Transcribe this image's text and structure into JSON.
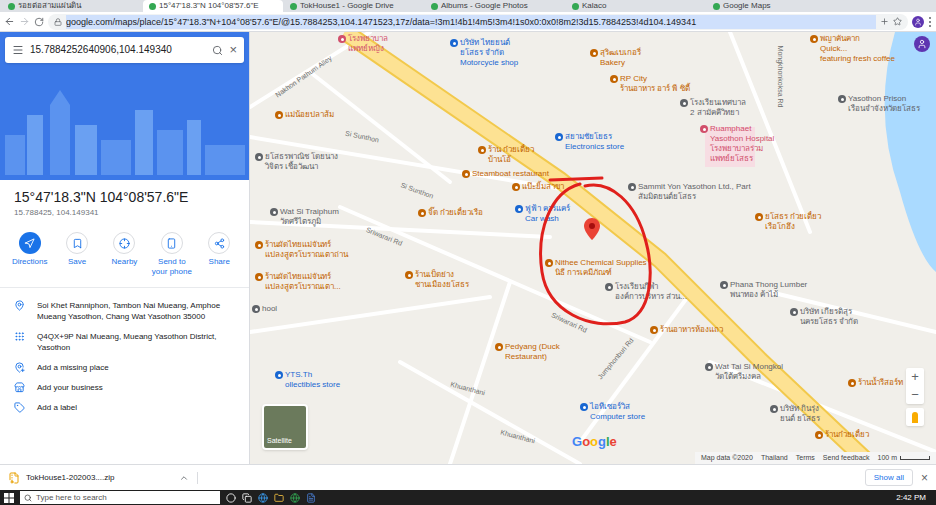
{
  "browser": {
    "tabs": [
      {
        "label": "รอยต่อสามแผ่นดิน",
        "selected": false
      },
      {
        "label": "15°47'18.3\"N 104°08'57.6\"E",
        "selected": true
      },
      {
        "label": "TokHouse1 - Google Drive",
        "selected": false
      },
      {
        "label": "Albums - Google Photos",
        "selected": false
      },
      {
        "label": "Kalaco",
        "selected": false
      },
      {
        "label": "Google Maps",
        "selected": false
      }
    ],
    "url": "google.com/maps/place/15°47'18.3\"N+104°08'57.6\"E/@15.7884253,104.1471523,17z/data=!3m1!4b1!4m5!3m4!1s0x0:0x0!8m2!3d15.7884253!4d104.149341"
  },
  "side_panel": {
    "search": {
      "value": "15.7884252640906,104.149340",
      "clear": "×"
    },
    "title": "15°47'18.3\"N 104°08'57.6\"E",
    "subtitle": "15.788425, 104.149341",
    "actions": [
      {
        "label": "Directions",
        "primary": true
      },
      {
        "label": "Save",
        "primary": false
      },
      {
        "label": "Nearby",
        "primary": false
      },
      {
        "label": "Send to your phone",
        "primary": false
      },
      {
        "label": "Share",
        "primary": false
      }
    ],
    "details": [
      {
        "text": "Soi Khet Ranniphon, Tambon Nai Mueang, Amphoe Mueang Yasothon, Chang Wat Yasothon 35000",
        "kind": "address"
      },
      {
        "text": "Q4QX+9P Nai Mueang, Mueang Yasothon District, Yasothon",
        "kind": "pluscode"
      },
      {
        "text": "Add a missing place",
        "kind": "place"
      },
      {
        "text": "Add your business",
        "kind": "business"
      },
      {
        "text": "Add a label",
        "kind": "label"
      }
    ]
  },
  "map": {
    "labels": [
      {
        "lines": [
          "โรงพยาบาล",
          "แพทย์หญิง"
        ],
        "color": "#d14f6b"
      },
      {
        "lines": [
          "บริษัท ไทยยนต์",
          "ยโสธร จำกัด",
          "Motorcycle shop"
        ],
        "color": "#1967d2"
      },
      {
        "lines": [
          "สุริฒเบเกอรี่",
          "Bakery"
        ],
        "color": "#c26401"
      },
      {
        "lines": [
          "RP City",
          "ร้านอาหาร อาร์ พี ซิตี้"
        ],
        "color": "#c26401"
      },
      {
        "lines": [
          "โรงเรียนเทศบาล",
          "2 สามัคคีวิทยา"
        ],
        "color": "#5f6368"
      },
      {
        "lines": [
          "พญาคันคาก",
          "Quick...",
          "featuring fresh coffee"
        ],
        "color": "#c26401"
      },
      {
        "lines": [
          "Yasothon Prison",
          "เรือนจำจังหวัดยโสธร"
        ],
        "color": "#5f6368"
      },
      {
        "lines": [
          "Ruamphaet",
          "Yasothon Hospital",
          "โรงพยาบาลร่วม",
          "แพทย์ยโสธร"
        ],
        "color": "#d14f6b"
      },
      {
        "lines": [
          "แม่น้อยปลาส้ม"
        ],
        "color": "#c26401"
      },
      {
        "lines": [
          "สยามชัยโยธร",
          "Electronics store"
        ],
        "color": "#1967d2"
      },
      {
        "lines": [
          "ร้าน ก๋วยเตี๋ยว",
          "บ้านโอ้"
        ],
        "color": "#c26401"
      },
      {
        "lines": [
          "Steamboat restaurant"
        ],
        "color": "#c26401"
      },
      {
        "lines": [
          "ยโสธรพาณิช โดยนาง",
          "วิจิตร เชื้อวัฒนา"
        ],
        "color": "#5f6368"
      },
      {
        "lines": [
          "แป๊ะยิ้มสาขา"
        ],
        "color": "#c26401"
      },
      {
        "lines": [
          "Wat Si Traiphum",
          "วัดศรีไตรภูมิ"
        ],
        "color": "#5f6368"
      },
      {
        "lines": [
          "จิ๊ด ก๋วยเตี๋ยวเรือ"
        ],
        "color": "#c26401"
      },
      {
        "lines": [
          "ฟูฟ้า คาร์แคร์",
          "Car wash"
        ],
        "color": "#1967d2"
      },
      {
        "lines": [
          "Sammit Yon Yasothon Ltd., Part",
          "สัมมิตยนต์ยโสธร"
        ],
        "color": "#5f6368"
      },
      {
        "lines": [
          "ยโสธร ก๋วยเตี๋ยว",
          "เรือโกฮึง"
        ],
        "color": "#c26401"
      },
      {
        "lines": [
          "ร้านผัดไทยแม่จันทร์",
          "แปลงสูตรโบราณเตาถ่าน"
        ],
        "color": "#c26401"
      },
      {
        "lines": [
          "Nithee Chemical Supplies",
          "นิธี การเคมีภัณฑ์"
        ],
        "color": "#c26401"
      },
      {
        "lines": [
          "โรงเรียนกีฬา",
          "องค์การบริหาร ส่วน..."
        ],
        "color": "#5f6368"
      },
      {
        "lines": [
          "Phana Thong Lumber",
          "พนาทอง ค้าไม้"
        ],
        "color": "#5f6368"
      },
      {
        "lines": [
          "บริษัท เกียรติสุร",
          "นครยโสธร จำกัด"
        ],
        "color": "#5f6368"
      },
      {
        "lines": [
          "ร้านผัดไทยแม่จันทร์",
          "แปลงสูตรโบราณเตา..."
        ],
        "color": "#c26401"
      },
      {
        "lines": [
          "ร้านเป็ดย่าง",
          "ชานเมืองยโสธร"
        ],
        "color": "#c26401"
      },
      {
        "lines": [
          "hool"
        ],
        "color": "#5f6368"
      },
      {
        "lines": [
          "ร้านอาหารห้องแถว"
        ],
        "color": "#c26401"
      },
      {
        "lines": [
          "Pedyang (Duck",
          "Restaurant)"
        ],
        "color": "#c26401"
      },
      {
        "lines": [
          "YTS.Th",
          "ollectibles store"
        ],
        "color": "#1967d2"
      },
      {
        "lines": [
          "Wat Tai Si Mongkol",
          "วัดใต้ศรีมงคล"
        ],
        "color": "#5f6368"
      },
      {
        "lines": [
          "ร้านน้ำรีสอร์ท"
        ],
        "color": "#c26401"
      },
      {
        "lines": [
          "ไอทีเซอร์วิส",
          "Computer store"
        ],
        "color": "#1967d2"
      },
      {
        "lines": [
          "บริษัท กินรุ่ง",
          "ยนต์ ยโสธร"
        ],
        "color": "#5f6368"
      },
      {
        "lines": [
          "ร้านก๋วยเตี๋ยว"
        ],
        "color": "#c26401"
      }
    ],
    "roads": [
      {
        "text": "Nakhon Pathum Alley"
      },
      {
        "text": "Si Sunthon"
      },
      {
        "text": "Si Sunthon"
      },
      {
        "text": "Mongkhonkoksa Rd"
      },
      {
        "text": "Sriwarari Rd"
      },
      {
        "text": "Sriwarari Rd"
      },
      {
        "text": "Jumphonburi Rd"
      },
      {
        "text": "Khuanthani"
      },
      {
        "text": "Khuanthani"
      }
    ],
    "logo": "Google",
    "layer_button": "Satellite",
    "zoom": [
      "+",
      "−"
    ],
    "footer": {
      "links": [
        "Map data ©2020",
        "Thailand",
        "Terms",
        "Send feedback"
      ],
      "scale": "100 m"
    }
  },
  "downloads": {
    "items": [
      {
        "name": "TokHouse1-202003....zip"
      }
    ],
    "show_all": "Show all",
    "close": "×"
  },
  "taskbar": {
    "search_placeholder": "Type here to search",
    "time": "2:42 PM"
  }
}
